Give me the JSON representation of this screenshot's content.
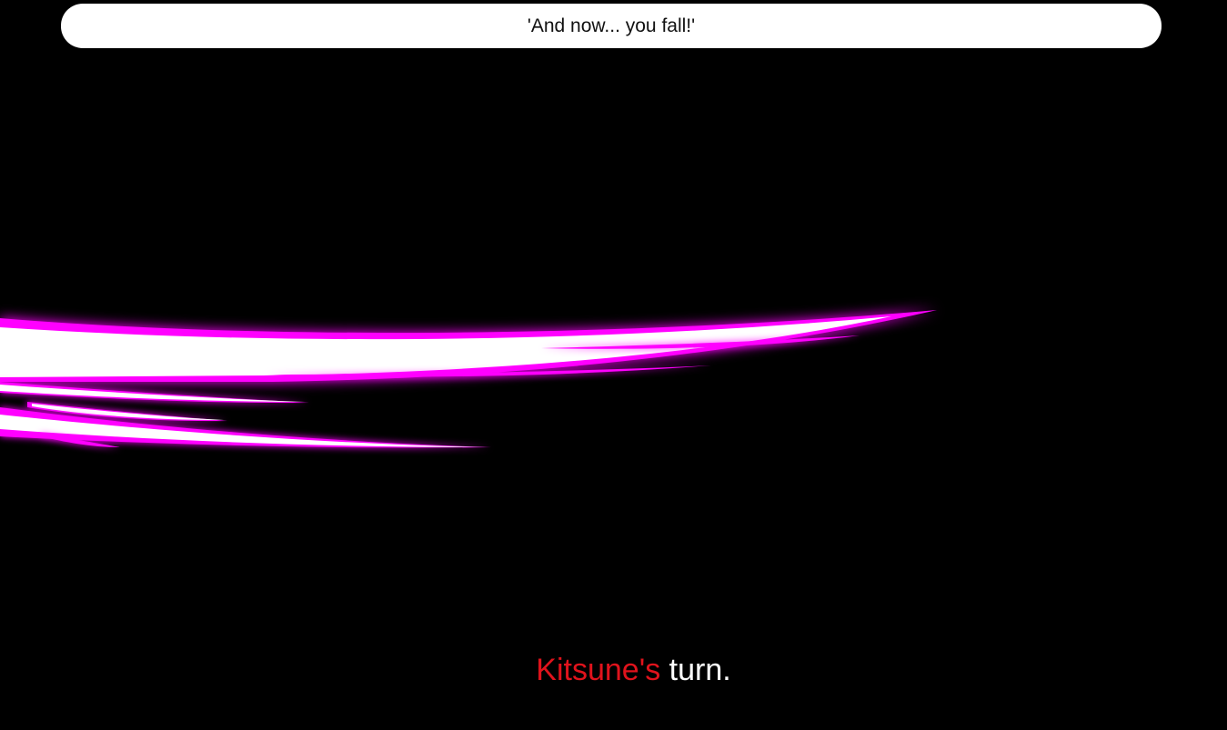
{
  "dialogue": {
    "text": "'And now... you fall!'"
  },
  "effect": {
    "icon": "slash-effect-icon",
    "glow_color": "#ff00ff",
    "core_color": "#ffffff"
  },
  "turn": {
    "name": "Kitsune's",
    "suffix": " turn.",
    "name_color": "#e0131c",
    "suffix_color": "#ffffff"
  },
  "background_color": "#000000"
}
